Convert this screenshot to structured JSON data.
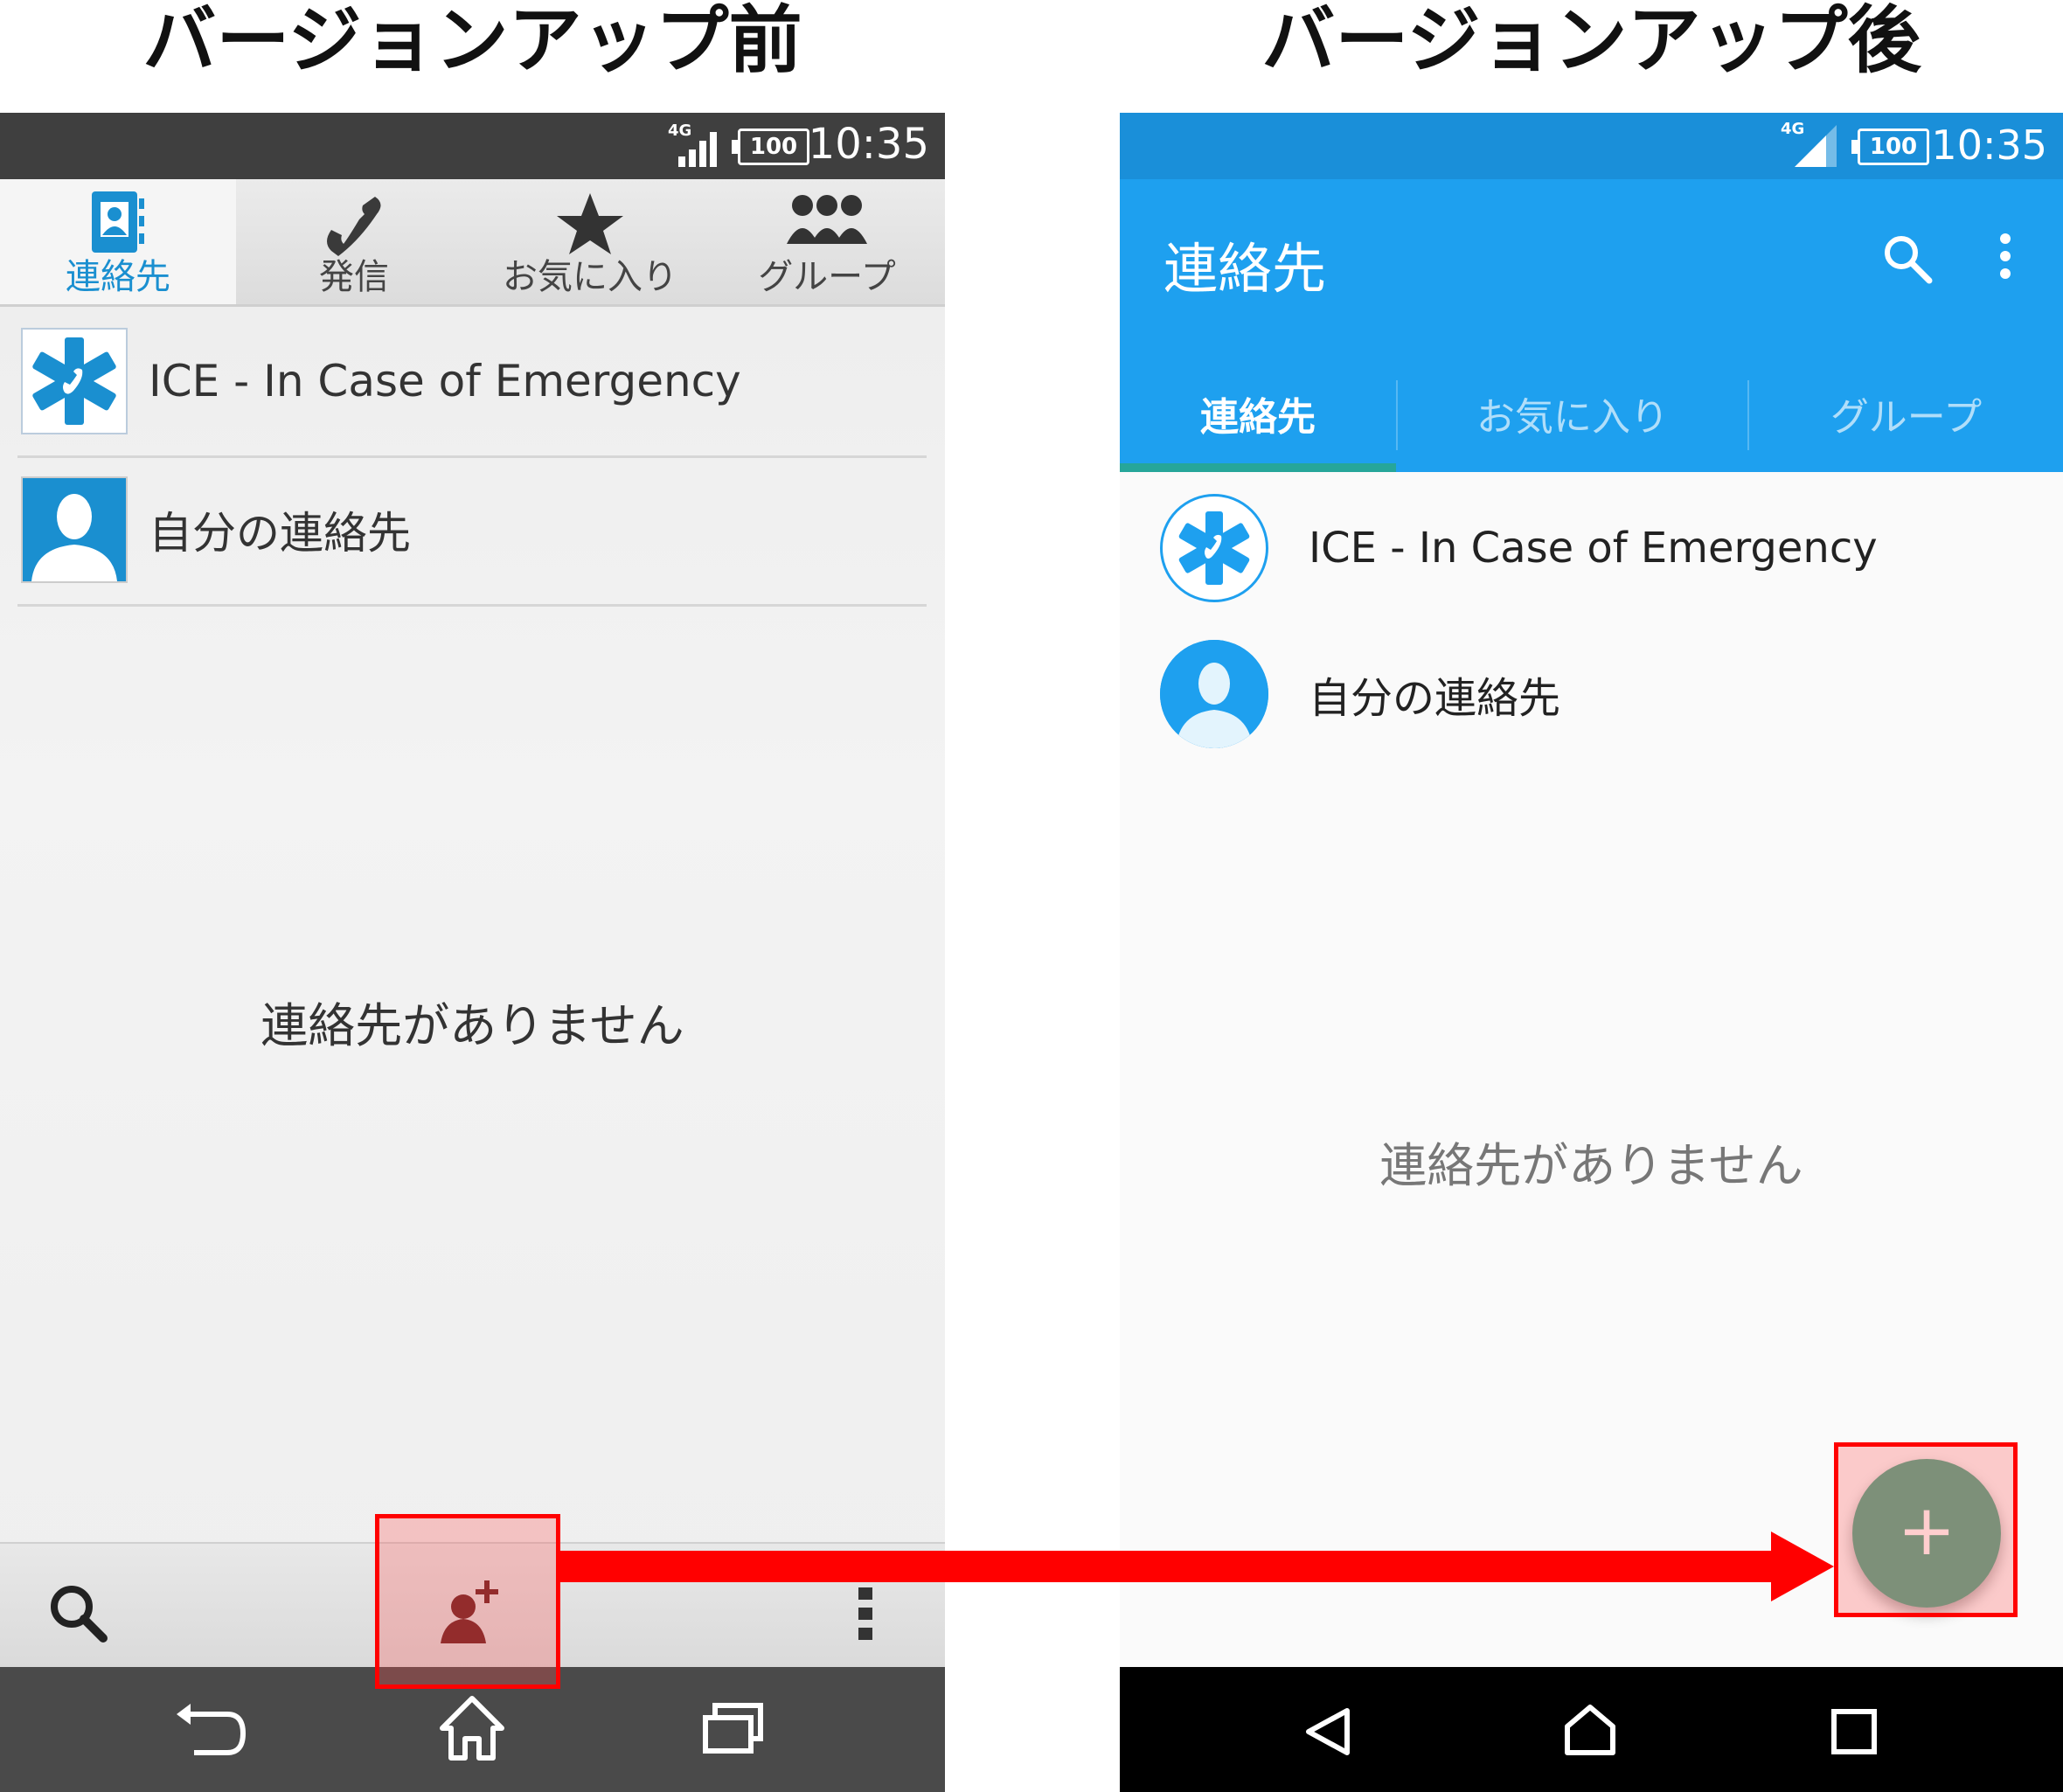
{
  "headings": {
    "before": "バージョンアップ前",
    "after": "バージョンアップ後"
  },
  "status": {
    "network": "4G",
    "battery": "100",
    "time": "10:35"
  },
  "old_phone": {
    "tabs": [
      "連絡先",
      "発信",
      "お気に入り",
      "グループ"
    ],
    "contacts": [
      "ICE - In Case of Emergency",
      "自分の連絡先"
    ],
    "empty_message": "連絡先がありません"
  },
  "new_phone": {
    "app_title": "連絡先",
    "tabs": [
      "連絡先",
      "お気に入り",
      "グループ"
    ],
    "contacts": [
      "ICE - In Case of Emergency",
      "自分の連絡先"
    ],
    "empty_message": "連絡先がありません",
    "fab_symbol": "+"
  },
  "colors": {
    "highlight": "#ff0000",
    "appbar": "#1ea0ef",
    "fab": "#4caa8a",
    "tab_indicator": "#26a69a"
  }
}
